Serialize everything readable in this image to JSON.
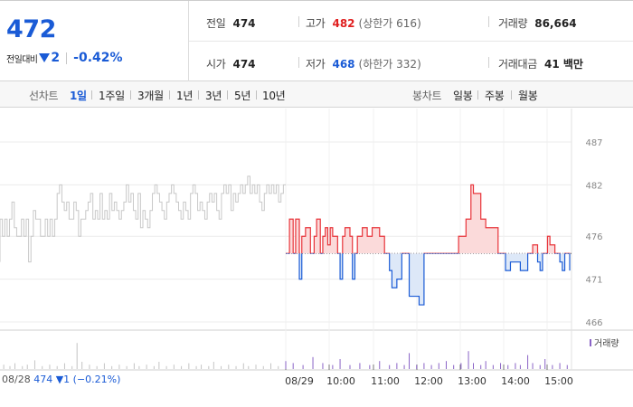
{
  "quote": {
    "price": "472",
    "change_label": "전일대비",
    "change_value": "2",
    "change_percent": "-0.42%",
    "prev_close_label": "전일",
    "prev_close": "474",
    "high_label": "고가",
    "high": "482",
    "upper_limit": "(상한가 616)",
    "volume_label": "거래량",
    "volume": "86,664",
    "open_label": "시가",
    "open": "474",
    "low_label": "저가",
    "low": "468",
    "lower_limit": "(하한가 332)",
    "amount_label": "거래대금",
    "amount": "41 백만"
  },
  "toolbar": {
    "line_label": "선차트",
    "line_periods": [
      "1일",
      "1주일",
      "3개월",
      "1년",
      "3년",
      "5년",
      "10년"
    ],
    "active_period": "1일",
    "candle_label": "봉차트",
    "candle_periods": [
      "일봉",
      "주봉",
      "월봉"
    ]
  },
  "chart_data": {
    "type": "line",
    "y_ticks": [
      "487",
      "482",
      "476",
      "471",
      "466"
    ],
    "x_labels": [
      "08/29",
      "10:00",
      "11:00",
      "12:00",
      "13:00",
      "14:00",
      "15:00"
    ],
    "prev_day": {
      "date": "08/28",
      "value": "474 ▼1 (−0.21%)"
    },
    "volume_legend": "거래량",
    "baseline": 474,
    "ylim": [
      465,
      488
    ],
    "colors": {
      "up": "#e8343a",
      "down": "#1a5bd6",
      "prev": "#c8c8c8",
      "volume": "#8a63c6"
    },
    "prev_series": [
      [
        0,
        473
      ],
      [
        0,
        478
      ],
      [
        1,
        478
      ],
      [
        1,
        476
      ],
      [
        2,
        476
      ],
      [
        2,
        478
      ],
      [
        3,
        478
      ],
      [
        3,
        476
      ],
      [
        4,
        476
      ],
      [
        4,
        478
      ],
      [
        5,
        478
      ],
      [
        5,
        480
      ],
      [
        6,
        480
      ],
      [
        6,
        477
      ],
      [
        7,
        477
      ],
      [
        7,
        476
      ],
      [
        8,
        476
      ],
      [
        8,
        476
      ],
      [
        9,
        476
      ],
      [
        9,
        478
      ],
      [
        10,
        478
      ],
      [
        10,
        476
      ],
      [
        11,
        476
      ],
      [
        11,
        478
      ],
      [
        12,
        478
      ],
      [
        12,
        473
      ],
      [
        13,
        473
      ],
      [
        13,
        476
      ],
      [
        14,
        476
      ],
      [
        14,
        479
      ],
      [
        15,
        479
      ],
      [
        15,
        478
      ],
      [
        16,
        478
      ],
      [
        16,
        478
      ],
      [
        17,
        478
      ],
      [
        17,
        476
      ],
      [
        18,
        476
      ],
      [
        18,
        476
      ],
      [
        19,
        476
      ],
      [
        19,
        478
      ],
      [
        20,
        478
      ],
      [
        20,
        476
      ],
      [
        21,
        476
      ],
      [
        21,
        478
      ],
      [
        22,
        478
      ],
      [
        22,
        476
      ],
      [
        23,
        476
      ],
      [
        23,
        478
      ],
      [
        24,
        478
      ],
      [
        24,
        481
      ],
      [
        25,
        481
      ],
      [
        25,
        482
      ],
      [
        26,
        482
      ],
      [
        26,
        480
      ],
      [
        27,
        480
      ],
      [
        27,
        479
      ],
      [
        28,
        479
      ],
      [
        28,
        480
      ],
      [
        29,
        480
      ],
      [
        29,
        478
      ],
      [
        30,
        478
      ],
      [
        30,
        478
      ],
      [
        31,
        478
      ],
      [
        31,
        480
      ],
      [
        32,
        480
      ],
      [
        32,
        479
      ],
      [
        33,
        479
      ],
      [
        33,
        476
      ],
      [
        34,
        476
      ],
      [
        34,
        478
      ],
      [
        35,
        478
      ],
      [
        35,
        478
      ],
      [
        36,
        478
      ],
      [
        36,
        479
      ],
      [
        37,
        479
      ],
      [
        37,
        480
      ],
      [
        38,
        480
      ],
      [
        38,
        481
      ],
      [
        39,
        481
      ],
      [
        39,
        478
      ],
      [
        40,
        478
      ],
      [
        40,
        479
      ],
      [
        41,
        479
      ],
      [
        41,
        478
      ],
      [
        42,
        478
      ],
      [
        42,
        481
      ],
      [
        43,
        481
      ],
      [
        43,
        478
      ],
      [
        44,
        478
      ],
      [
        44,
        479
      ],
      [
        45,
        479
      ],
      [
        45,
        478
      ],
      [
        46,
        478
      ],
      [
        46,
        481
      ],
      [
        47,
        481
      ],
      [
        47,
        479
      ],
      [
        48,
        479
      ],
      [
        48,
        480
      ],
      [
        49,
        480
      ],
      [
        49,
        479
      ],
      [
        50,
        479
      ],
      [
        50,
        478
      ],
      [
        51,
        478
      ],
      [
        51,
        479
      ],
      [
        52,
        479
      ],
      [
        52,
        480
      ],
      [
        53,
        480
      ],
      [
        53,
        482
      ],
      [
        54,
        482
      ],
      [
        54,
        480
      ],
      [
        55,
        480
      ],
      [
        55,
        481
      ],
      [
        56,
        481
      ],
      [
        56,
        479
      ],
      [
        57,
        479
      ],
      [
        57,
        478
      ],
      [
        58,
        478
      ],
      [
        58,
        481
      ],
      [
        59,
        481
      ],
      [
        59,
        477
      ],
      [
        60,
        477
      ],
      [
        60,
        479
      ],
      [
        61,
        479
      ],
      [
        61,
        478
      ],
      [
        62,
        478
      ],
      [
        62,
        477
      ],
      [
        63,
        477
      ],
      [
        63,
        479
      ],
      [
        64,
        479
      ],
      [
        64,
        481
      ],
      [
        65,
        481
      ],
      [
        65,
        482
      ],
      [
        66,
        482
      ],
      [
        66,
        481
      ],
      [
        67,
        481
      ],
      [
        67,
        480
      ],
      [
        68,
        480
      ],
      [
        68,
        479
      ],
      [
        69,
        479
      ],
      [
        69,
        478
      ],
      [
        70,
        478
      ],
      [
        70,
        480
      ],
      [
        71,
        480
      ],
      [
        71,
        481
      ],
      [
        72,
        481
      ],
      [
        72,
        482
      ],
      [
        73,
        482
      ],
      [
        73,
        481
      ],
      [
        74,
        481
      ],
      [
        74,
        480
      ],
      [
        75,
        480
      ],
      [
        75,
        479
      ],
      [
        76,
        479
      ],
      [
        76,
        478
      ],
      [
        77,
        478
      ],
      [
        77,
        480
      ],
      [
        78,
        480
      ],
      [
        78,
        479
      ],
      [
        79,
        479
      ],
      [
        79,
        478
      ],
      [
        80,
        478
      ],
      [
        80,
        481
      ],
      [
        81,
        481
      ],
      [
        81,
        482
      ],
      [
        82,
        482
      ],
      [
        82,
        481
      ],
      [
        83,
        481
      ],
      [
        83,
        479
      ],
      [
        84,
        479
      ],
      [
        84,
        480
      ],
      [
        85,
        480
      ],
      [
        85,
        479
      ],
      [
        86,
        479
      ],
      [
        86,
        478
      ],
      [
        87,
        478
      ],
      [
        87,
        480
      ],
      [
        88,
        480
      ],
      [
        88,
        481
      ],
      [
        89,
        481
      ],
      [
        89,
        480
      ],
      [
        90,
        480
      ],
      [
        90,
        481
      ],
      [
        91,
        481
      ],
      [
        91,
        479
      ],
      [
        92,
        479
      ],
      [
        92,
        478
      ],
      [
        93,
        478
      ],
      [
        93,
        481
      ],
      [
        94,
        481
      ],
      [
        94,
        482
      ],
      [
        95,
        482
      ],
      [
        95,
        481
      ],
      [
        96,
        481
      ],
      [
        96,
        482
      ],
      [
        97,
        482
      ],
      [
        97,
        479
      ],
      [
        98,
        479
      ],
      [
        98,
        481
      ],
      [
        99,
        481
      ],
      [
        99,
        480
      ],
      [
        100,
        480
      ],
      [
        100,
        481
      ],
      [
        101,
        481
      ],
      [
        101,
        482
      ],
      [
        102,
        482
      ],
      [
        102,
        481
      ],
      [
        103,
        481
      ],
      [
        103,
        482
      ],
      [
        104,
        482
      ],
      [
        104,
        483
      ],
      [
        105,
        483
      ],
      [
        105,
        481
      ],
      [
        106,
        481
      ],
      [
        106,
        482
      ],
      [
        107,
        482
      ],
      [
        107,
        481
      ],
      [
        108,
        481
      ],
      [
        108,
        482
      ],
      [
        109,
        482
      ],
      [
        109,
        480
      ],
      [
        110,
        480
      ],
      [
        110,
        479
      ],
      [
        111,
        479
      ],
      [
        111,
        481
      ],
      [
        112,
        481
      ],
      [
        112,
        482
      ],
      [
        113,
        482
      ],
      [
        113,
        481
      ],
      [
        114,
        481
      ],
      [
        114,
        482
      ],
      [
        115,
        482
      ],
      [
        115,
        481
      ],
      [
        116,
        481
      ],
      [
        116,
        482
      ],
      [
        117,
        482
      ],
      [
        117,
        480
      ],
      [
        118,
        480
      ],
      [
        118,
        481
      ],
      [
        119,
        481
      ],
      [
        119,
        482
      ],
      [
        120,
        482
      ]
    ],
    "today_series": [
      [
        0,
        474
      ],
      [
        3,
        474
      ],
      [
        3,
        478
      ],
      [
        6,
        478
      ],
      [
        6,
        474
      ],
      [
        8,
        474
      ],
      [
        8,
        478
      ],
      [
        11,
        478
      ],
      [
        11,
        471
      ],
      [
        13,
        471
      ],
      [
        13,
        476
      ],
      [
        16,
        476
      ],
      [
        16,
        477
      ],
      [
        20,
        477
      ],
      [
        20,
        474
      ],
      [
        23,
        474
      ],
      [
        23,
        476
      ],
      [
        25,
        476
      ],
      [
        25,
        478
      ],
      [
        28,
        478
      ],
      [
        28,
        474
      ],
      [
        30,
        474
      ],
      [
        30,
        476
      ],
      [
        32,
        476
      ],
      [
        32,
        477
      ],
      [
        34,
        477
      ],
      [
        34,
        475
      ],
      [
        36,
        475
      ],
      [
        36,
        477
      ],
      [
        38,
        477
      ],
      [
        38,
        476
      ],
      [
        42,
        476
      ],
      [
        42,
        474
      ],
      [
        44,
        474
      ],
      [
        44,
        471
      ],
      [
        46,
        471
      ],
      [
        46,
        476
      ],
      [
        48,
        476
      ],
      [
        48,
        477
      ],
      [
        52,
        477
      ],
      [
        52,
        476
      ],
      [
        54,
        476
      ],
      [
        54,
        471
      ],
      [
        56,
        471
      ],
      [
        56,
        474
      ],
      [
        58,
        474
      ],
      [
        58,
        476
      ],
      [
        62,
        476
      ],
      [
        62,
        477
      ],
      [
        66,
        477
      ],
      [
        66,
        476
      ],
      [
        70,
        476
      ],
      [
        70,
        477
      ],
      [
        76,
        477
      ],
      [
        76,
        476
      ],
      [
        80,
        476
      ],
      [
        80,
        474
      ],
      [
        84,
        474
      ],
      [
        84,
        472
      ],
      [
        86,
        472
      ],
      [
        86,
        470
      ],
      [
        90,
        470
      ],
      [
        90,
        471
      ],
      [
        94,
        471
      ],
      [
        94,
        474
      ],
      [
        100,
        474
      ],
      [
        100,
        469
      ],
      [
        108,
        469
      ],
      [
        108,
        468
      ],
      [
        112,
        468
      ],
      [
        112,
        474
      ],
      [
        118,
        474
      ],
      [
        118,
        474
      ],
      [
        124,
        474
      ],
      [
        124,
        474
      ],
      [
        130,
        474
      ],
      [
        130,
        474
      ],
      [
        140,
        474
      ],
      [
        140,
        476
      ],
      [
        146,
        476
      ],
      [
        146,
        478
      ],
      [
        150,
        478
      ],
      [
        150,
        482
      ],
      [
        152,
        482
      ],
      [
        152,
        481
      ],
      [
        158,
        481
      ],
      [
        158,
        478
      ],
      [
        162,
        478
      ],
      [
        162,
        477
      ],
      [
        166,
        477
      ],
      [
        166,
        477
      ],
      [
        172,
        477
      ],
      [
        172,
        474
      ],
      [
        178,
        474
      ],
      [
        178,
        472
      ],
      [
        182,
        472
      ],
      [
        182,
        473
      ],
      [
        186,
        473
      ],
      [
        186,
        473
      ],
      [
        190,
        473
      ],
      [
        190,
        472
      ],
      [
        196,
        472
      ],
      [
        196,
        474
      ],
      [
        200,
        474
      ],
      [
        200,
        475
      ],
      [
        204,
        475
      ],
      [
        204,
        473
      ],
      [
        206,
        473
      ],
      [
        206,
        472
      ],
      [
        208,
        472
      ],
      [
        208,
        474
      ],
      [
        212,
        474
      ],
      [
        212,
        476
      ],
      [
        214,
        476
      ],
      [
        214,
        475
      ],
      [
        218,
        475
      ],
      [
        218,
        474
      ],
      [
        222,
        474
      ],
      [
        222,
        473
      ],
      [
        224,
        473
      ],
      [
        224,
        472
      ],
      [
        226,
        472
      ],
      [
        226,
        474
      ],
      [
        230,
        474
      ],
      [
        230,
        472
      ]
    ],
    "volume_bars": [
      [
        3,
        3
      ],
      [
        8,
        2
      ],
      [
        12,
        4
      ],
      [
        18,
        2
      ],
      [
        22,
        3
      ],
      [
        28,
        6
      ],
      [
        34,
        2
      ],
      [
        40,
        3
      ],
      [
        46,
        2
      ],
      [
        52,
        4
      ],
      [
        58,
        2
      ],
      [
        62,
        18
      ],
      [
        66,
        5
      ],
      [
        72,
        3
      ],
      [
        78,
        2
      ],
      [
        84,
        4
      ],
      [
        90,
        2
      ],
      [
        96,
        3
      ],
      [
        102,
        2
      ],
      [
        108,
        4
      ],
      [
        112,
        2
      ],
      [
        118,
        3
      ],
      [
        124,
        2
      ],
      [
        128,
        5
      ],
      [
        134,
        2
      ],
      [
        140,
        3
      ],
      [
        146,
        2
      ],
      [
        152,
        4
      ],
      [
        158,
        2
      ],
      [
        162,
        3
      ],
      [
        168,
        2
      ],
      [
        172,
        5
      ],
      [
        178,
        2
      ],
      [
        184,
        3
      ],
      [
        190,
        2
      ],
      [
        196,
        4
      ],
      [
        200,
        2
      ],
      [
        206,
        3
      ],
      [
        212,
        2
      ],
      [
        218,
        4
      ],
      [
        224,
        2
      ],
      [
        230,
        3
      ]
    ],
    "volume_bars_today": [
      [
        0,
        4
      ],
      [
        6,
        3
      ],
      [
        14,
        2
      ],
      [
        22,
        6
      ],
      [
        30,
        3
      ],
      [
        38,
        2
      ],
      [
        44,
        5
      ],
      [
        52,
        2
      ],
      [
        60,
        3
      ],
      [
        68,
        2
      ],
      [
        76,
        4
      ],
      [
        84,
        2
      ],
      [
        90,
        3
      ],
      [
        96,
        2
      ],
      [
        100,
        8
      ],
      [
        106,
        2
      ],
      [
        112,
        3
      ],
      [
        118,
        2
      ],
      [
        124,
        3
      ],
      [
        130,
        4
      ],
      [
        136,
        2
      ],
      [
        142,
        3
      ],
      [
        148,
        9
      ],
      [
        152,
        3
      ],
      [
        158,
        2
      ],
      [
        162,
        4
      ],
      [
        168,
        2
      ],
      [
        174,
        3
      ],
      [
        180,
        2
      ],
      [
        186,
        3
      ],
      [
        190,
        2
      ],
      [
        196,
        7
      ],
      [
        200,
        3
      ],
      [
        206,
        2
      ],
      [
        210,
        5
      ],
      [
        216,
        2
      ],
      [
        222,
        3
      ],
      [
        228,
        2
      ]
    ]
  }
}
